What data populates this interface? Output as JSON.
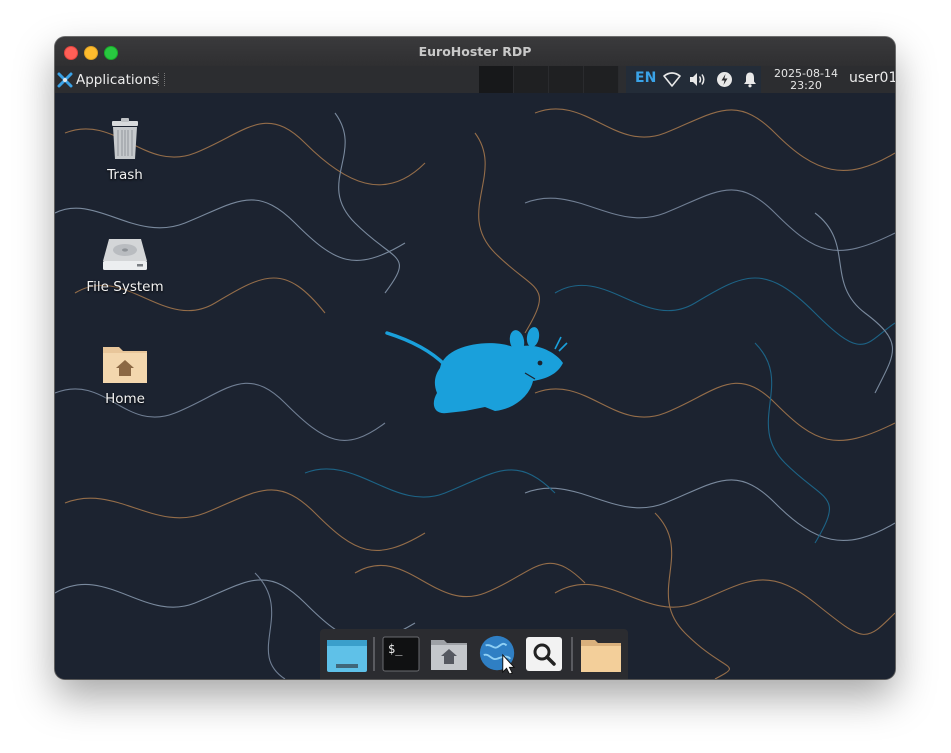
{
  "window": {
    "title": "EuroHoster RDP"
  },
  "panel": {
    "applications_label": "Applications",
    "language": "EN",
    "date": "2025-08-14",
    "time": "23:20",
    "username": "user01",
    "tray_icons": [
      "network-wifi-icon",
      "volume-icon",
      "power-icon",
      "notification-bell-icon"
    ]
  },
  "desktop": {
    "icons": [
      {
        "label": "Trash",
        "icon": "trash-icon"
      },
      {
        "label": "File System",
        "icon": "hard-drive-icon"
      },
      {
        "label": "Home",
        "icon": "home-folder-icon"
      }
    ]
  },
  "dock": {
    "items": [
      "show-desktop-icon",
      "terminal-icon",
      "file-manager-icon",
      "web-browser-icon",
      "app-finder-icon",
      "folder-icon"
    ]
  },
  "colors": {
    "accent": "#3aa3e8",
    "mouse_logo": "#1aa0db",
    "desktop_bg": "#1c2330"
  }
}
